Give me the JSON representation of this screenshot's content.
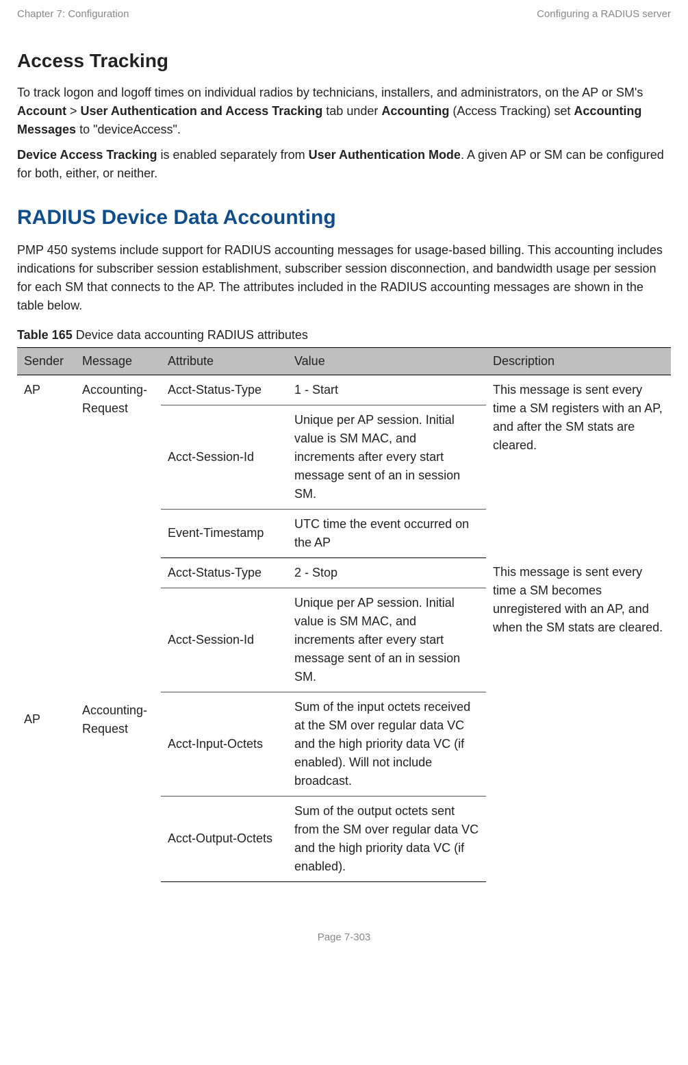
{
  "header": {
    "left": "Chapter 7:  Configuration",
    "right": "Configuring a RADIUS server"
  },
  "section1": {
    "title": "Access Tracking",
    "p1_a": "To track logon and logoff times on individual radios by technicians, installers, and administrators, on the AP or SM's ",
    "p1_b": "Account",
    "p1_c": " > ",
    "p1_d": "User Authentication and Access Tracking",
    "p1_e": " tab under ",
    "p1_f": "Accounting",
    "p1_g": " (Access Tracking) set ",
    "p1_h": "Accounting Messages",
    "p1_i": " to \"deviceAccess\".",
    "p2_a": "Device Access Tracking",
    "p2_b": " is enabled separately from ",
    "p2_c": "User Authentication Mode",
    "p2_d": ". A given AP or SM can be configured for both, either, or neither."
  },
  "section2": {
    "title": "RADIUS Device Data Accounting",
    "p1": "PMP 450 systems include support for RADIUS accounting messages for usage-based billing. This accounting includes indications for subscriber session establishment, subscriber session disconnection, and bandwidth usage per session for each SM that connects to the AP. The attributes included in the RADIUS accounting messages are shown in the table below."
  },
  "table": {
    "caption_label": "Table 165",
    "caption_text": " Device data accounting RADIUS attributes",
    "headers": {
      "sender": "Sender",
      "message": "Message",
      "attribute": "Attribute",
      "value": "Value",
      "description": "Description"
    },
    "groups": [
      {
        "sender": "AP",
        "message": "Accounting-Request",
        "description": "This message is sent every time a SM registers with an AP, and after the SM stats are cleared.",
        "rows": [
          {
            "attribute": "Acct-Status-Type",
            "value": "1 - Start"
          },
          {
            "attribute": "Acct-Session-Id",
            "value": "Unique per AP session. Initial value is SM MAC, and increments after every start message sent of an in session SM."
          },
          {
            "attribute": "Event-Timestamp",
            "value": "UTC time the event occurred on the AP"
          }
        ]
      },
      {
        "sender": "AP",
        "message": "Accounting-Request",
        "description": "This message is sent every time a SM becomes unregistered with an AP, and when the SM stats are cleared.",
        "rows": [
          {
            "attribute": "Acct-Status-Type",
            "value": "2 - Stop"
          },
          {
            "attribute": "Acct-Session-Id",
            "value": "Unique per AP session. Initial value is SM MAC, and increments after every start message sent of an in session SM."
          },
          {
            "attribute": "Acct-Input-Octets",
            "value": "Sum of the input octets received at the SM over regular data VC and the high priority data VC (if enabled). Will not include broadcast."
          },
          {
            "attribute": "Acct-Output-Octets",
            "value": "Sum of the output octets sent from the SM over regular data VC and the high priority data VC (if enabled)."
          }
        ]
      }
    ]
  },
  "footer": "Page 7-303"
}
